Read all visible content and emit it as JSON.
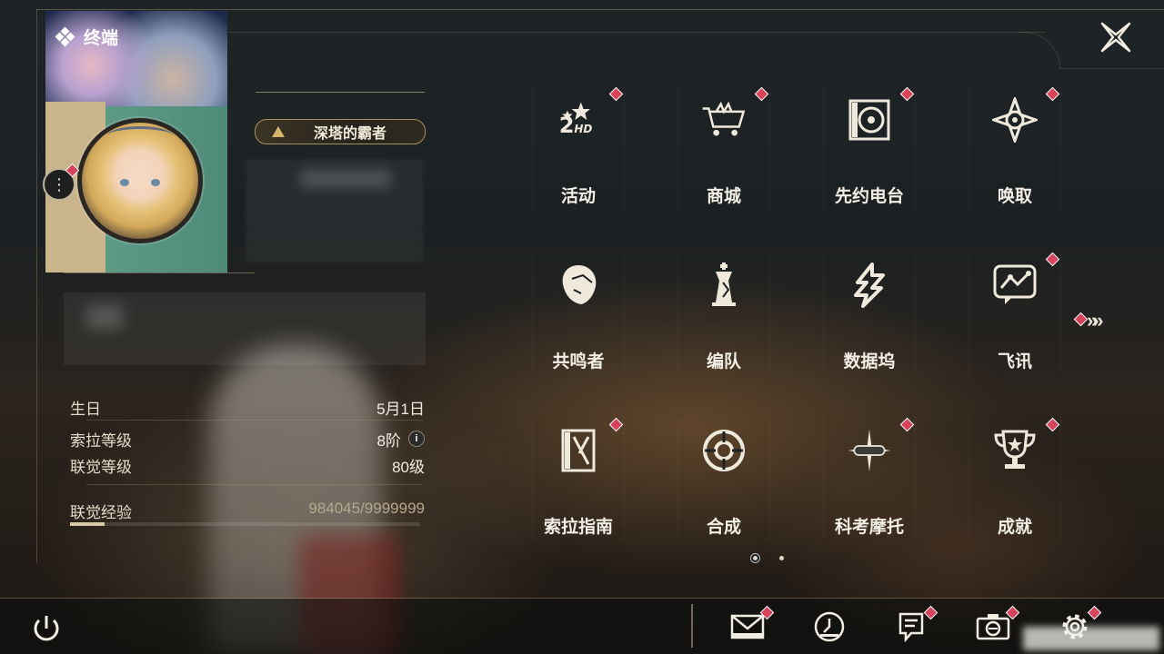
{
  "header": {
    "section_title": "终端"
  },
  "profile": {
    "title_badge": "深塔的霸者",
    "stats": [
      {
        "key": "生日",
        "value": "5月1日"
      },
      {
        "key": "索拉等级",
        "value": "8阶"
      },
      {
        "key": "联觉等级",
        "value": "80级"
      }
    ],
    "exp": {
      "label": "联觉经验",
      "value": "984045/9999999",
      "progress": 0.098
    }
  },
  "menu": {
    "items": [
      {
        "label": "活动",
        "icon": "event-2hd-icon",
        "badge": true
      },
      {
        "label": "商城",
        "icon": "shop-cart-icon",
        "badge": true
      },
      {
        "label": "先约电台",
        "icon": "radio-record-icon",
        "badge": true
      },
      {
        "label": "唤取",
        "icon": "convene-compass-icon",
        "badge": true
      },
      {
        "label": "共鸣者",
        "icon": "resonator-head-icon",
        "badge": false
      },
      {
        "label": "编队",
        "icon": "chess-team-icon",
        "badge": false
      },
      {
        "label": "数据坞",
        "icon": "data-bank-icon",
        "badge": false
      },
      {
        "label": "飞讯",
        "icon": "message-chat-icon",
        "badge": true
      },
      {
        "label": "索拉指南",
        "icon": "guide-book-icon",
        "badge": true
      },
      {
        "label": "合成",
        "icon": "synthesis-ring-icon",
        "badge": false
      },
      {
        "label": "科考摩托",
        "icon": "motorcycle-icon",
        "badge": true
      },
      {
        "label": "成就",
        "icon": "trophy-icon",
        "badge": true
      }
    ],
    "pages": 2,
    "current_page": 1
  },
  "bottom_bar": {
    "icons": [
      {
        "name": "mail-icon",
        "badge": true
      },
      {
        "name": "clock-icon",
        "badge": false
      },
      {
        "name": "notice-icon",
        "badge": true
      },
      {
        "name": "camera-icon",
        "badge": true
      },
      {
        "name": "settings-gear-icon",
        "badge": true
      }
    ]
  },
  "colors": {
    "badge_red": "#d7435b",
    "gold": "#c9b48c",
    "accent_green": "#5d9a86"
  }
}
